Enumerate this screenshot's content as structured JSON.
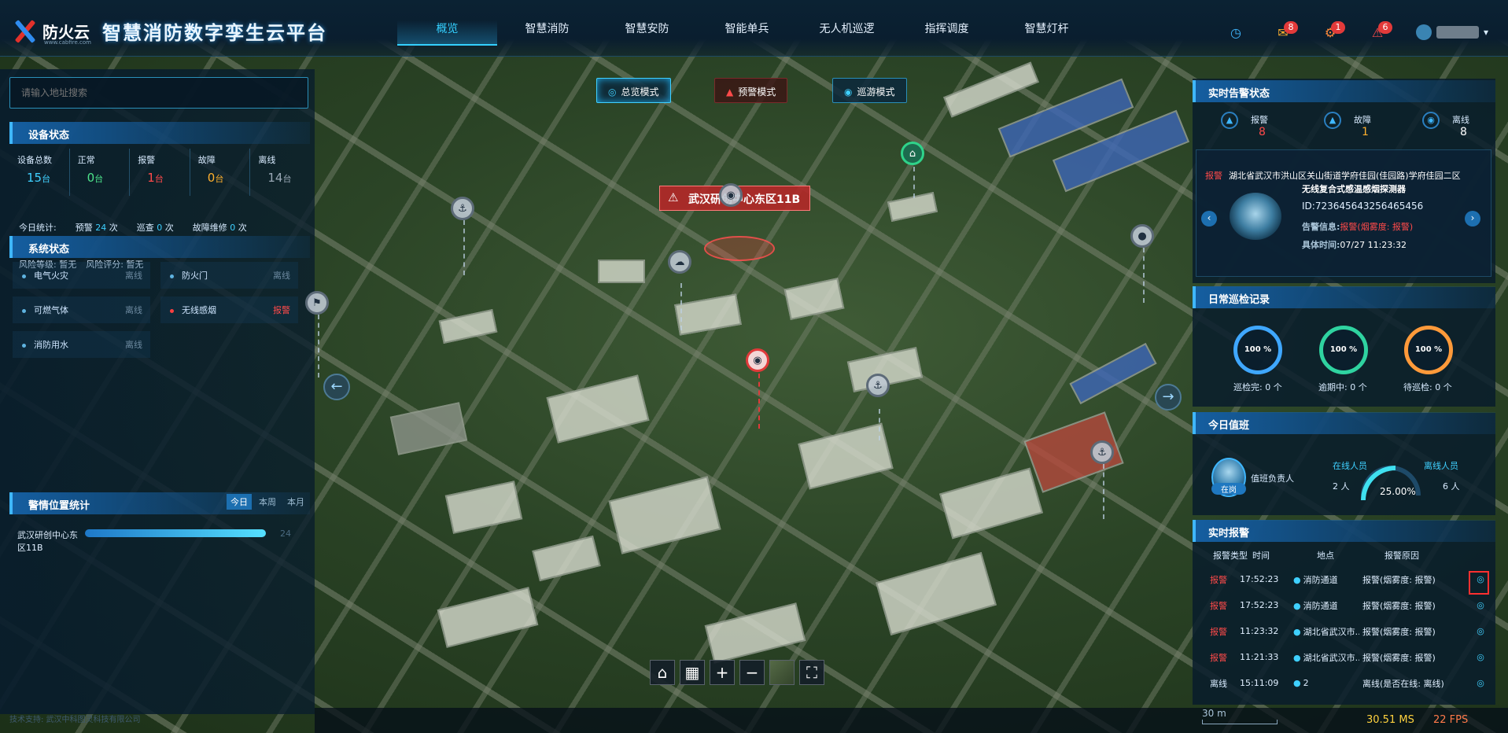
{
  "header": {
    "brand": "防火云",
    "brand_url": "www.cabfire.com",
    "title": "智慧消防数字孪生云平台",
    "nav": [
      "概览",
      "智慧消防",
      "智慧安防",
      "智能单兵",
      "无人机巡逻",
      "指挥调度",
      "智慧灯杆"
    ],
    "active_nav": "概览",
    "badges": {
      "clock": "",
      "messages": "8",
      "settings": "1",
      "alarms": "6"
    }
  },
  "left": {
    "search_placeholder": "请输入地址搜索",
    "device_status_title": "设备状态",
    "device_stats": [
      {
        "label": "设备总数",
        "value": "15",
        "unit": "台",
        "color": "#3fd0ff"
      },
      {
        "label": "正常",
        "value": "0",
        "unit": "台",
        "color": "#4de38a"
      },
      {
        "label": "报警",
        "value": "1",
        "unit": "台",
        "color": "#ff4a4a"
      },
      {
        "label": "故障",
        "value": "0",
        "unit": "台",
        "color": "#ffb02e"
      },
      {
        "label": "离线",
        "value": "14",
        "unit": "台",
        "color": "#9aa9b6"
      }
    ],
    "today_label": "今日统计:",
    "today": [
      {
        "label": "预警",
        "value": "24",
        "unit": "次"
      },
      {
        "label": "巡查",
        "value": "0",
        "unit": "次"
      },
      {
        "label": "故障维修",
        "value": "0",
        "unit": "次"
      }
    ],
    "risk_level": "风险等级: 暂无",
    "risk_score": "风险评分: 暂无",
    "system_status_title": "系统状态",
    "systems": [
      {
        "name": "电气火灾",
        "status": "离线"
      },
      {
        "name": "防火门",
        "status": "离线"
      },
      {
        "name": "可燃气体",
        "status": "离线"
      },
      {
        "name": "无线感烟",
        "status": "报警"
      },
      {
        "name": "消防用水",
        "status": "离线"
      }
    ],
    "alarm_stat_title": "警情位置统计",
    "alarm_tabs": [
      "今日",
      "本周",
      "本月"
    ],
    "alarm_location": "武汉研创中心东区11B",
    "alarm_count": "24",
    "alarm_fraction": 1.0,
    "credit": "技术支持: 武汉中科图灵科技有限公司"
  },
  "map": {
    "modes": [
      "总览模式",
      "预警模式",
      "巡游模式"
    ],
    "alert_label": "武汉研创中心东区11B",
    "toolbar": [
      "home",
      "building",
      "zoom-in",
      "zoom-out",
      "layer",
      "fullscreen"
    ],
    "scale": "30 m",
    "ms": "30.51 MS",
    "fps": "22 FPS"
  },
  "right": {
    "realtime_alert_title": "实时告警状态",
    "alert_counts": [
      {
        "label": "报警",
        "value": "8",
        "color": "#ff4a4a"
      },
      {
        "label": "故障",
        "value": "1",
        "color": "#ffb02e"
      },
      {
        "label": "离线",
        "value": "8",
        "color": "#ffffff"
      }
    ],
    "alert_card": {
      "tag": "报警",
      "address": "湖北省武汉市洪山区关山街道学府佳园(佳园路)学府佳园二区",
      "device": "无线复合式感温感烟探测器",
      "id": "ID:723645643256465456",
      "info_label": "告警信息:",
      "info_value": "报警(烟雾度: 报警)",
      "time_label": "具体时间:",
      "time_value": "07/27 11:23:32"
    },
    "patrol_title": "日常巡检记录",
    "patrol": [
      {
        "label": "巡检完:",
        "count": "0 个",
        "pct": "100 %",
        "color": "#3fa7ff"
      },
      {
        "label": "逾期中:",
        "count": "0 个",
        "pct": "100 %",
        "color": "#2fd3a0"
      },
      {
        "label": "待巡检:",
        "count": "0 个",
        "pct": "100 %",
        "color": "#ff9a3a"
      }
    ],
    "duty_title": "今日值班",
    "duty_status": "在岗",
    "duty_role": "值班负责人",
    "online_label": "在线人员",
    "online_count": "2 人",
    "offline_label": "离线人员",
    "offline_count": "6 人",
    "online_pct": "25.00%",
    "online_fraction": 0.25,
    "rt_title": "实时报警",
    "rt_headers": [
      "报警类型",
      "时间",
      "地点",
      "报警原因"
    ],
    "rt_rows": [
      {
        "type": "报警",
        "time": "17:52:23",
        "place": "消防通道",
        "reason": "报警(烟雾度: 报警)"
      },
      {
        "type": "报警",
        "time": "17:52:23",
        "place": "消防通道",
        "reason": "报警(烟雾度: 报警)"
      },
      {
        "type": "报警",
        "time": "11:23:32",
        "place": "湖北省武汉市...",
        "reason": "报警(烟雾度: 报警)"
      },
      {
        "type": "报警",
        "time": "11:21:33",
        "place": "湖北省武汉市...",
        "reason": "报警(烟雾度: 报警)"
      },
      {
        "type": "离线",
        "time": "15:11:09",
        "place": "2",
        "reason": "离线(是否在线: 离线)"
      }
    ]
  }
}
